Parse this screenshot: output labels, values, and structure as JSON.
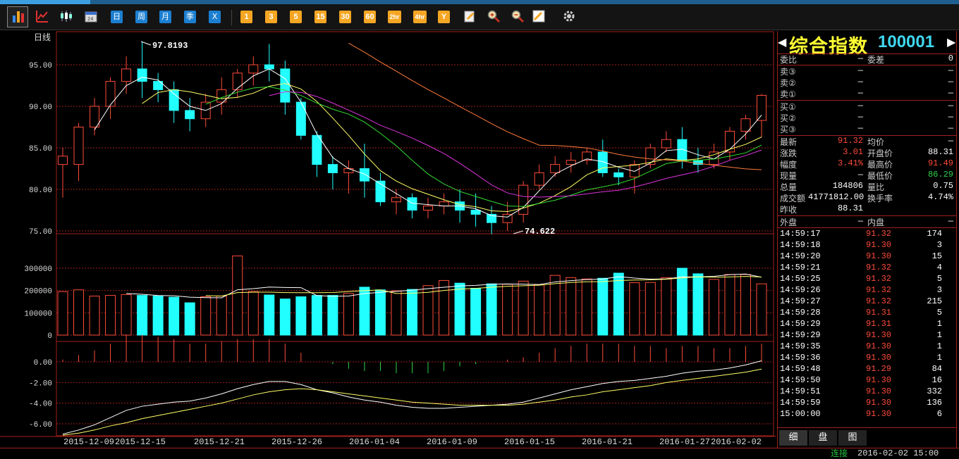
{
  "toolbar": {
    "period_buttons": [
      "日",
      "周",
      "月",
      "季",
      "X"
    ],
    "minute_buttons": [
      "1",
      "3",
      "5",
      "15",
      "30",
      "60",
      "2hr",
      "4hr",
      "Y"
    ]
  },
  "chart": {
    "period_label": "日线",
    "high_label": "97.8193",
    "low_label": "74.622",
    "price_ticks": [
      "95.00",
      "90.00",
      "85.00",
      "80.00",
      "75.00"
    ],
    "volume_ticks": [
      "300000",
      "200000",
      "100000",
      "0"
    ],
    "macd_ticks": [
      "0.00",
      "-2.00",
      "-4.00",
      "-6.00"
    ],
    "date_labels": [
      "2015-12-09",
      "2015-12-15",
      "2015-12-21",
      "2015-12-26",
      "2016-01-04",
      "2016-01-09",
      "2016-01-15",
      "2016-01-21",
      "2016-01-27",
      "2016-02-02"
    ]
  },
  "chart_data": {
    "type": "candlestick",
    "price_range": [
      74.6,
      98
    ],
    "candles": [
      [
        83.0,
        84.0,
        79.0,
        85.0
      ],
      [
        83.0,
        87.5,
        81.0,
        88.0
      ],
      [
        87.5,
        90.0,
        86.5,
        91.0
      ],
      [
        90.0,
        93.0,
        88.5,
        93.5
      ],
      [
        93.0,
        94.5,
        91.5,
        96.0
      ],
      [
        94.5,
        93.0,
        91.0,
        97.8
      ],
      [
        93.0,
        92.0,
        90.5,
        94.0
      ],
      [
        92.0,
        89.5,
        88.0,
        93.0
      ],
      [
        89.5,
        88.5,
        87.0,
        91.0
      ],
      [
        88.5,
        90.5,
        87.5,
        91.5
      ],
      [
        90.5,
        92.0,
        89.0,
        93.5
      ],
      [
        92.0,
        94.0,
        91.0,
        94.5
      ],
      [
        94.0,
        95.0,
        92.5,
        96.0
      ],
      [
        95.0,
        94.5,
        93.0,
        97.5
      ],
      [
        94.5,
        90.5,
        89.0,
        95.5
      ],
      [
        90.5,
        86.5,
        86.0,
        91.0
      ],
      [
        86.5,
        83.0,
        81.5,
        87.0
      ],
      [
        83.0,
        82.0,
        80.0,
        84.0
      ],
      [
        82.0,
        82.5,
        79.5,
        83.5
      ],
      [
        82.5,
        81.0,
        79.0,
        85.5
      ],
      [
        81.0,
        78.5,
        78.0,
        82.0
      ],
      [
        78.5,
        79.0,
        77.0,
        80.0
      ],
      [
        79.0,
        77.5,
        76.5,
        79.5
      ],
      [
        77.5,
        78.0,
        76.5,
        79.0
      ],
      [
        78.0,
        78.5,
        77.0,
        79.5
      ],
      [
        78.5,
        77.5,
        76.0,
        80.0
      ],
      [
        77.5,
        77.0,
        75.5,
        79.5
      ],
      [
        77.0,
        76.0,
        74.6,
        78.0
      ],
      [
        76.0,
        77.0,
        75.0,
        78.5
      ],
      [
        77.0,
        80.5,
        76.0,
        81.0
      ],
      [
        80.5,
        82.0,
        80.0,
        83.0
      ],
      [
        82.0,
        83.0,
        81.5,
        84.0
      ],
      [
        83.0,
        83.5,
        82.0,
        84.5
      ],
      [
        83.5,
        84.5,
        83.0,
        85.0
      ],
      [
        84.5,
        82.0,
        81.5,
        86.0
      ],
      [
        82.0,
        81.5,
        80.5,
        82.5
      ],
      [
        81.5,
        83.0,
        79.5,
        83.5
      ],
      [
        83.0,
        85.0,
        82.5,
        85.5
      ],
      [
        85.0,
        86.0,
        84.5,
        87.0
      ],
      [
        86.0,
        83.5,
        82.5,
        87.5
      ],
      [
        83.5,
        83.0,
        82.0,
        85.0
      ],
      [
        83.0,
        84.5,
        82.5,
        85.5
      ],
      [
        84.5,
        87.0,
        83.5,
        87.5
      ],
      [
        87.0,
        88.5,
        86.0,
        89.0
      ],
      [
        88.3,
        91.32,
        86.29,
        91.49
      ]
    ],
    "volumes": [
      195000,
      203000,
      175000,
      178000,
      182000,
      178000,
      175000,
      170000,
      145000,
      172000,
      175000,
      355000,
      195000,
      180000,
      162000,
      172000,
      178000,
      178000,
      187000,
      215000,
      203000,
      198000,
      205000,
      222000,
      245000,
      233000,
      210000,
      230000,
      228000,
      242000,
      225000,
      268000,
      258000,
      252000,
      255000,
      278000,
      235000,
      236000,
      258000,
      300000,
      275000,
      250000,
      272000,
      272000,
      230000,
      205000,
      188000
    ],
    "macd_dif": [
      -7.0,
      -6.6,
      -6.1,
      -5.4,
      -4.7,
      -4.3,
      -4.1,
      -3.9,
      -3.8,
      -3.5,
      -3.1,
      -2.6,
      -2.2,
      -1.9,
      -1.9,
      -2.2,
      -2.7,
      -3.0,
      -3.4,
      -3.7,
      -3.9,
      -4.2,
      -4.4,
      -4.5,
      -4.5,
      -4.4,
      -4.3,
      -4.2,
      -4.1,
      -3.9,
      -3.5,
      -3.1,
      -2.7,
      -2.4,
      -2.1,
      -1.9,
      -1.8,
      -1.6,
      -1.4,
      -1.1,
      -0.9,
      -0.8,
      -0.6,
      -0.3,
      0.1,
      0.4
    ],
    "macd_dea": [
      -7.1,
      -6.9,
      -6.6,
      -6.2,
      -5.9,
      -5.5,
      -5.2,
      -4.9,
      -4.6,
      -4.3,
      -4.0,
      -3.6,
      -3.2,
      -2.9,
      -2.7,
      -2.6,
      -2.7,
      -2.9,
      -3.1,
      -3.3,
      -3.5,
      -3.7,
      -3.9,
      -4.0,
      -4.1,
      -4.2,
      -4.2,
      -4.2,
      -4.2,
      -4.1,
      -3.9,
      -3.7,
      -3.4,
      -3.2,
      -2.9,
      -2.7,
      -2.5,
      -2.3,
      -2.0,
      -1.8,
      -1.6,
      -1.4,
      -1.2,
      -1.0,
      -0.7,
      -0.4
    ]
  },
  "quote": {
    "name": "综合指数",
    "code": "100001",
    "weibi_label": "委比",
    "weibi_value": "—",
    "weicha_label": "委差",
    "weicha_value": "0",
    "sell3_label": "卖③",
    "sell2_label": "卖②",
    "sell1_label": "卖①",
    "buy1_label": "买①",
    "buy2_label": "买②",
    "buy3_label": "买③",
    "dash": "—",
    "latest_label": "最新",
    "latest_value": "91.32",
    "avg_label": "均价",
    "avg_value": "—",
    "change_label": "涨跌",
    "change_value": "3.01",
    "open_label": "开盘价",
    "open_value": "88.31",
    "pct_label": "幅度",
    "pct_value": "3.41%",
    "high_label": "最高价",
    "high_value": "91.49",
    "vol_now_label": "现量",
    "vol_now_value": "—",
    "low_label": "最低价",
    "low_value": "86.29",
    "total_label": "总量",
    "total_value": "184806",
    "ratio_label": "量比",
    "ratio_value": "0.75",
    "amount_label": "成交额",
    "amount_value": "41771812.00",
    "turnover_label": "换手率",
    "turnover_value": "4.74%",
    "prev_label": "昨收",
    "prev_value": "88.31",
    "outer_label": "外盘",
    "outer_value": "—",
    "inner_label": "内盘",
    "inner_value": "—"
  },
  "ticks": [
    {
      "time": "14:59:17",
      "price": "91.32",
      "vol": "174"
    },
    {
      "time": "14:59:18",
      "price": "91.30",
      "vol": "3"
    },
    {
      "time": "14:59:20",
      "price": "91.30",
      "vol": "15"
    },
    {
      "time": "14:59:21",
      "price": "91.32",
      "vol": "4"
    },
    {
      "time": "14:59:25",
      "price": "91.32",
      "vol": "5"
    },
    {
      "time": "14:59:26",
      "price": "91.32",
      "vol": "3"
    },
    {
      "time": "14:59:27",
      "price": "91.32",
      "vol": "215"
    },
    {
      "time": "14:59:28",
      "price": "91.31",
      "vol": "5"
    },
    {
      "time": "14:59:29",
      "price": "91.31",
      "vol": "1"
    },
    {
      "time": "14:59:29",
      "price": "91.30",
      "vol": "1"
    },
    {
      "time": "14:59:35",
      "price": "91.30",
      "vol": "1"
    },
    {
      "time": "14:59:36",
      "price": "91.30",
      "vol": "1"
    },
    {
      "time": "14:59:48",
      "price": "91.29",
      "vol": "84"
    },
    {
      "time": "14:59:50",
      "price": "91.30",
      "vol": "16"
    },
    {
      "time": "14:59:51",
      "price": "91.30",
      "vol": "332"
    },
    {
      "time": "14:59:59",
      "price": "91.30",
      "vol": "136"
    },
    {
      "time": "15:00:00",
      "price": "91.30",
      "vol": "6"
    }
  ],
  "tabs": [
    "细",
    "盘",
    "图"
  ],
  "status": {
    "connection": "连接",
    "datetime": "2016-02-02 15:00"
  },
  "colors": {
    "up": "#ff4b3a",
    "down": "#22ffff",
    "grid": "#a0201c"
  }
}
